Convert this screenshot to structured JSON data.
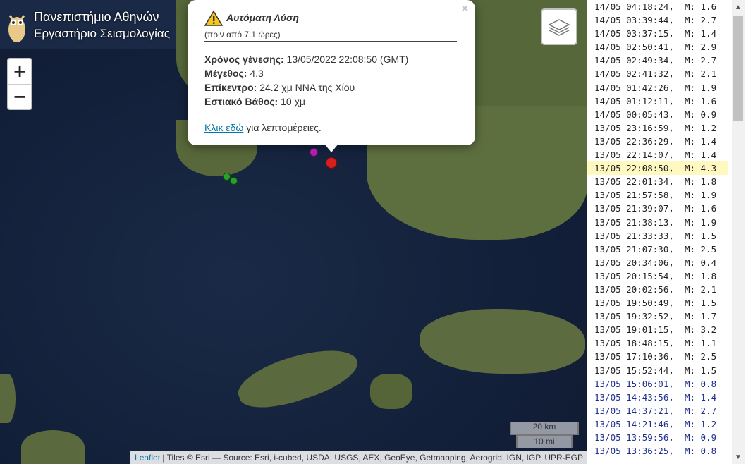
{
  "logo": {
    "line1": "Πανεπιστήμιο Αθηνών",
    "line2": "Εργαστήριο Σεισμολογίας"
  },
  "zoom": {
    "in": "+",
    "out": "−"
  },
  "popup": {
    "title": "Αυτόματη Λύση",
    "ago": "(πριν από 7.1 ώρες)",
    "origin_label": "Χρόνος γένεσης:",
    "origin_value": " 13/05/2022 22:08:50 (GMT)",
    "mag_label": "Μέγεθος:",
    "mag_value": " 4.3",
    "epi_label": "Επίκεντρο:",
    "epi_value": " 24.2 χμ ΝΝΑ της Χίου",
    "depth_label": "Εστιακό Βάθος:",
    "depth_value": " 10 χμ",
    "link": "Κλικ εδώ",
    "link_rest": " για λεπτομέρειες.",
    "close": "×"
  },
  "scale": {
    "km": "20 km",
    "mi": "10 mi"
  },
  "attribution": {
    "leaflet": "Leaflet",
    "text": " | Tiles © Esri — Source: Esri, i-cubed, USDA, USGS, AEX, GeoEye, Getmapping, Aerogrid, IGN, IGP, UPR-EGP"
  },
  "events": [
    {
      "t": "14/05 04:18:24,",
      "m": "M: 1.6"
    },
    {
      "t": "14/05 03:39:44,",
      "m": "M: 2.7"
    },
    {
      "t": "14/05 03:37:15,",
      "m": "M: 1.4"
    },
    {
      "t": "14/05 02:50:41,",
      "m": "M: 2.9"
    },
    {
      "t": "14/05 02:49:34,",
      "m": "M: 2.7"
    },
    {
      "t": "14/05 02:41:32,",
      "m": "M: 2.1"
    },
    {
      "t": "14/05 01:42:26,",
      "m": "M: 1.9"
    },
    {
      "t": "14/05 01:12:11,",
      "m": "M: 1.6"
    },
    {
      "t": "14/05 00:05:43,",
      "m": "M: 0.9"
    },
    {
      "t": "13/05 23:16:59,",
      "m": "M: 1.2"
    },
    {
      "t": "13/05 22:36:29,",
      "m": "M: 1.4"
    },
    {
      "t": "13/05 22:14:07,",
      "m": "M: 1.4"
    },
    {
      "t": "13/05 22:08:50,",
      "m": "M: 4.3",
      "sel": true
    },
    {
      "t": "13/05 22:01:34,",
      "m": "M: 1.8"
    },
    {
      "t": "13/05 21:57:58,",
      "m": "M: 1.9"
    },
    {
      "t": "13/05 21:39:07,",
      "m": "M: 1.6"
    },
    {
      "t": "13/05 21:38:13,",
      "m": "M: 1.9"
    },
    {
      "t": "13/05 21:33:33,",
      "m": "M: 1.5"
    },
    {
      "t": "13/05 21:07:30,",
      "m": "M: 2.5"
    },
    {
      "t": "13/05 20:34:06,",
      "m": "M: 0.4"
    },
    {
      "t": "13/05 20:15:54,",
      "m": "M: 1.8"
    },
    {
      "t": "13/05 20:02:56,",
      "m": "M: 2.1"
    },
    {
      "t": "13/05 19:50:49,",
      "m": "M: 1.5"
    },
    {
      "t": "13/05 19:32:52,",
      "m": "M: 1.7"
    },
    {
      "t": "13/05 19:01:15,",
      "m": "M: 3.2"
    },
    {
      "t": "13/05 18:48:15,",
      "m": "M: 1.1"
    },
    {
      "t": "13/05 17:10:36,",
      "m": "M: 2.5"
    },
    {
      "t": "13/05 15:52:44,",
      "m": "M: 1.5"
    },
    {
      "t": "13/05 15:06:01,",
      "m": "M: 0.8",
      "blue": true
    },
    {
      "t": "13/05 14:43:56,",
      "m": "M: 1.4",
      "blue": true
    },
    {
      "t": "13/05 14:37:21,",
      "m": "M: 2.7",
      "blue": true
    },
    {
      "t": "13/05 14:21:46,",
      "m": "M: 1.2",
      "blue": true
    },
    {
      "t": "13/05 13:59:56,",
      "m": "M: 0.9",
      "blue": true
    },
    {
      "t": "13/05 13:36:25,",
      "m": "M: 0.8",
      "blue": true
    }
  ],
  "colors": {
    "event_red": "#d81e1e",
    "event_purple": "#b01eb0",
    "event_green": "#2aa02a",
    "selected_row": "#fff8c0"
  }
}
